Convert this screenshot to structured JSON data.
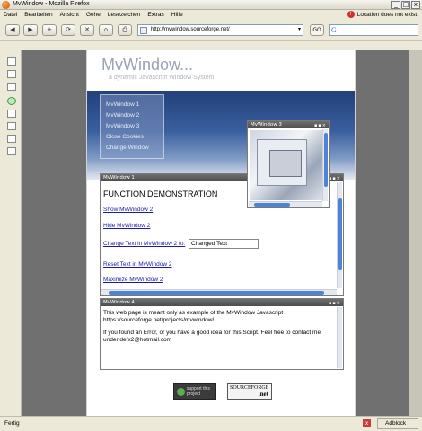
{
  "window": {
    "title": "MvWindow - Mozilla Firefox",
    "minimize": "_",
    "maximize": "□",
    "close": "x"
  },
  "menu": {
    "items": [
      "Datei",
      "Bearbeiten",
      "Ansicht",
      "Gehe",
      "Lesezeichen",
      "Extras",
      "Hilfe"
    ],
    "warning": "Location does not exist."
  },
  "navbar": {
    "back": "◀",
    "forward": "▶",
    "reload": "+",
    "stop": "⟳",
    "close": "✕",
    "home": "⌂",
    "print": "⎙",
    "url": "http://mvwindow.sourceforge.net/",
    "go_label": "GO",
    "search_icon": "G",
    "dropdown": "▾"
  },
  "page": {
    "site_title": "MvWindow...",
    "site_subtitle": "a dynamic Javascript Window System",
    "nav_links": [
      "MvWindow 1",
      "MvWindow 2",
      "MvWindow 3",
      "Close Cookies",
      "Change Window"
    ]
  },
  "mvwindow1": {
    "title": "MvWindow 1",
    "controls": "▪▪×",
    "heading": "FUNCTION DEMONSTRATION",
    "links": [
      "Show MvWindow 2",
      "Hide MvWindow 2",
      "Change Text in MvWindow 2 to:",
      "Reset Text in MvWindow 2",
      "Maximize MvWindow 2"
    ],
    "text_value": "Changed Text"
  },
  "mvwindow3": {
    "title": "MvWindow 3",
    "controls": "▪▪×"
  },
  "mvwindow4": {
    "title": "MvWindow 4",
    "controls": "▪▪×",
    "line1": "This web page is meant only as example of the MvWindow Javascript",
    "line2": "https://sourceforge.net/projects/mvwindow/",
    "line3": "If you found an Error, or you have a good idea for this Script. Feel free to contact me under defx2@hotmail.com"
  },
  "badges": {
    "support": "support this project",
    "sourceforge": "SOURCEFORGE",
    "net": ".net"
  },
  "status": {
    "text": "Fertig",
    "blocked": "Adblock",
    "x": "x"
  }
}
